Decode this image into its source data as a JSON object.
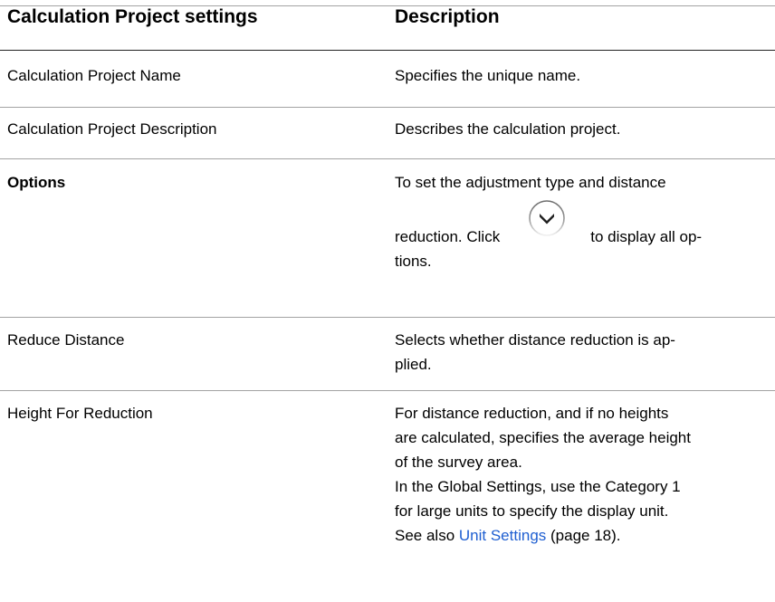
{
  "table": {
    "headers": {
      "settings": "Calculation Project settings",
      "description": "Description"
    },
    "rows": [
      {
        "setting": "Calculation Project Name",
        "description": "Specifies the unique name."
      },
      {
        "setting": "Calculation Project Description",
        "description": "Describes the calculation project."
      },
      {
        "setting": "Options",
        "description_line1": "To set the adjustment type and distance",
        "description_before_icon": "reduction. Click",
        "description_after_icon": "to display all op-",
        "description_last": "tions.",
        "icon": "chevron-down-circle-icon"
      },
      {
        "setting": "Reduce Distance",
        "description_line1": "Selects whether distance reduction is ap-",
        "description_line2": "plied."
      },
      {
        "setting": "Height For Reduction",
        "description_line1": "For distance reduction, and if no heights",
        "description_line2": "are calculated, specifies the average height",
        "description_line3": "of the survey area.",
        "description_line4": "In the Global Settings, use the Category 1",
        "description_line5": "for large units to specify the display unit.",
        "see_also_prefix": "See also ",
        "link_text": "Unit Settings",
        "see_also_suffix": " (page 18)."
      }
    ]
  },
  "colors": {
    "link": "#1f5fd1",
    "rule": "#a3a3a3"
  }
}
